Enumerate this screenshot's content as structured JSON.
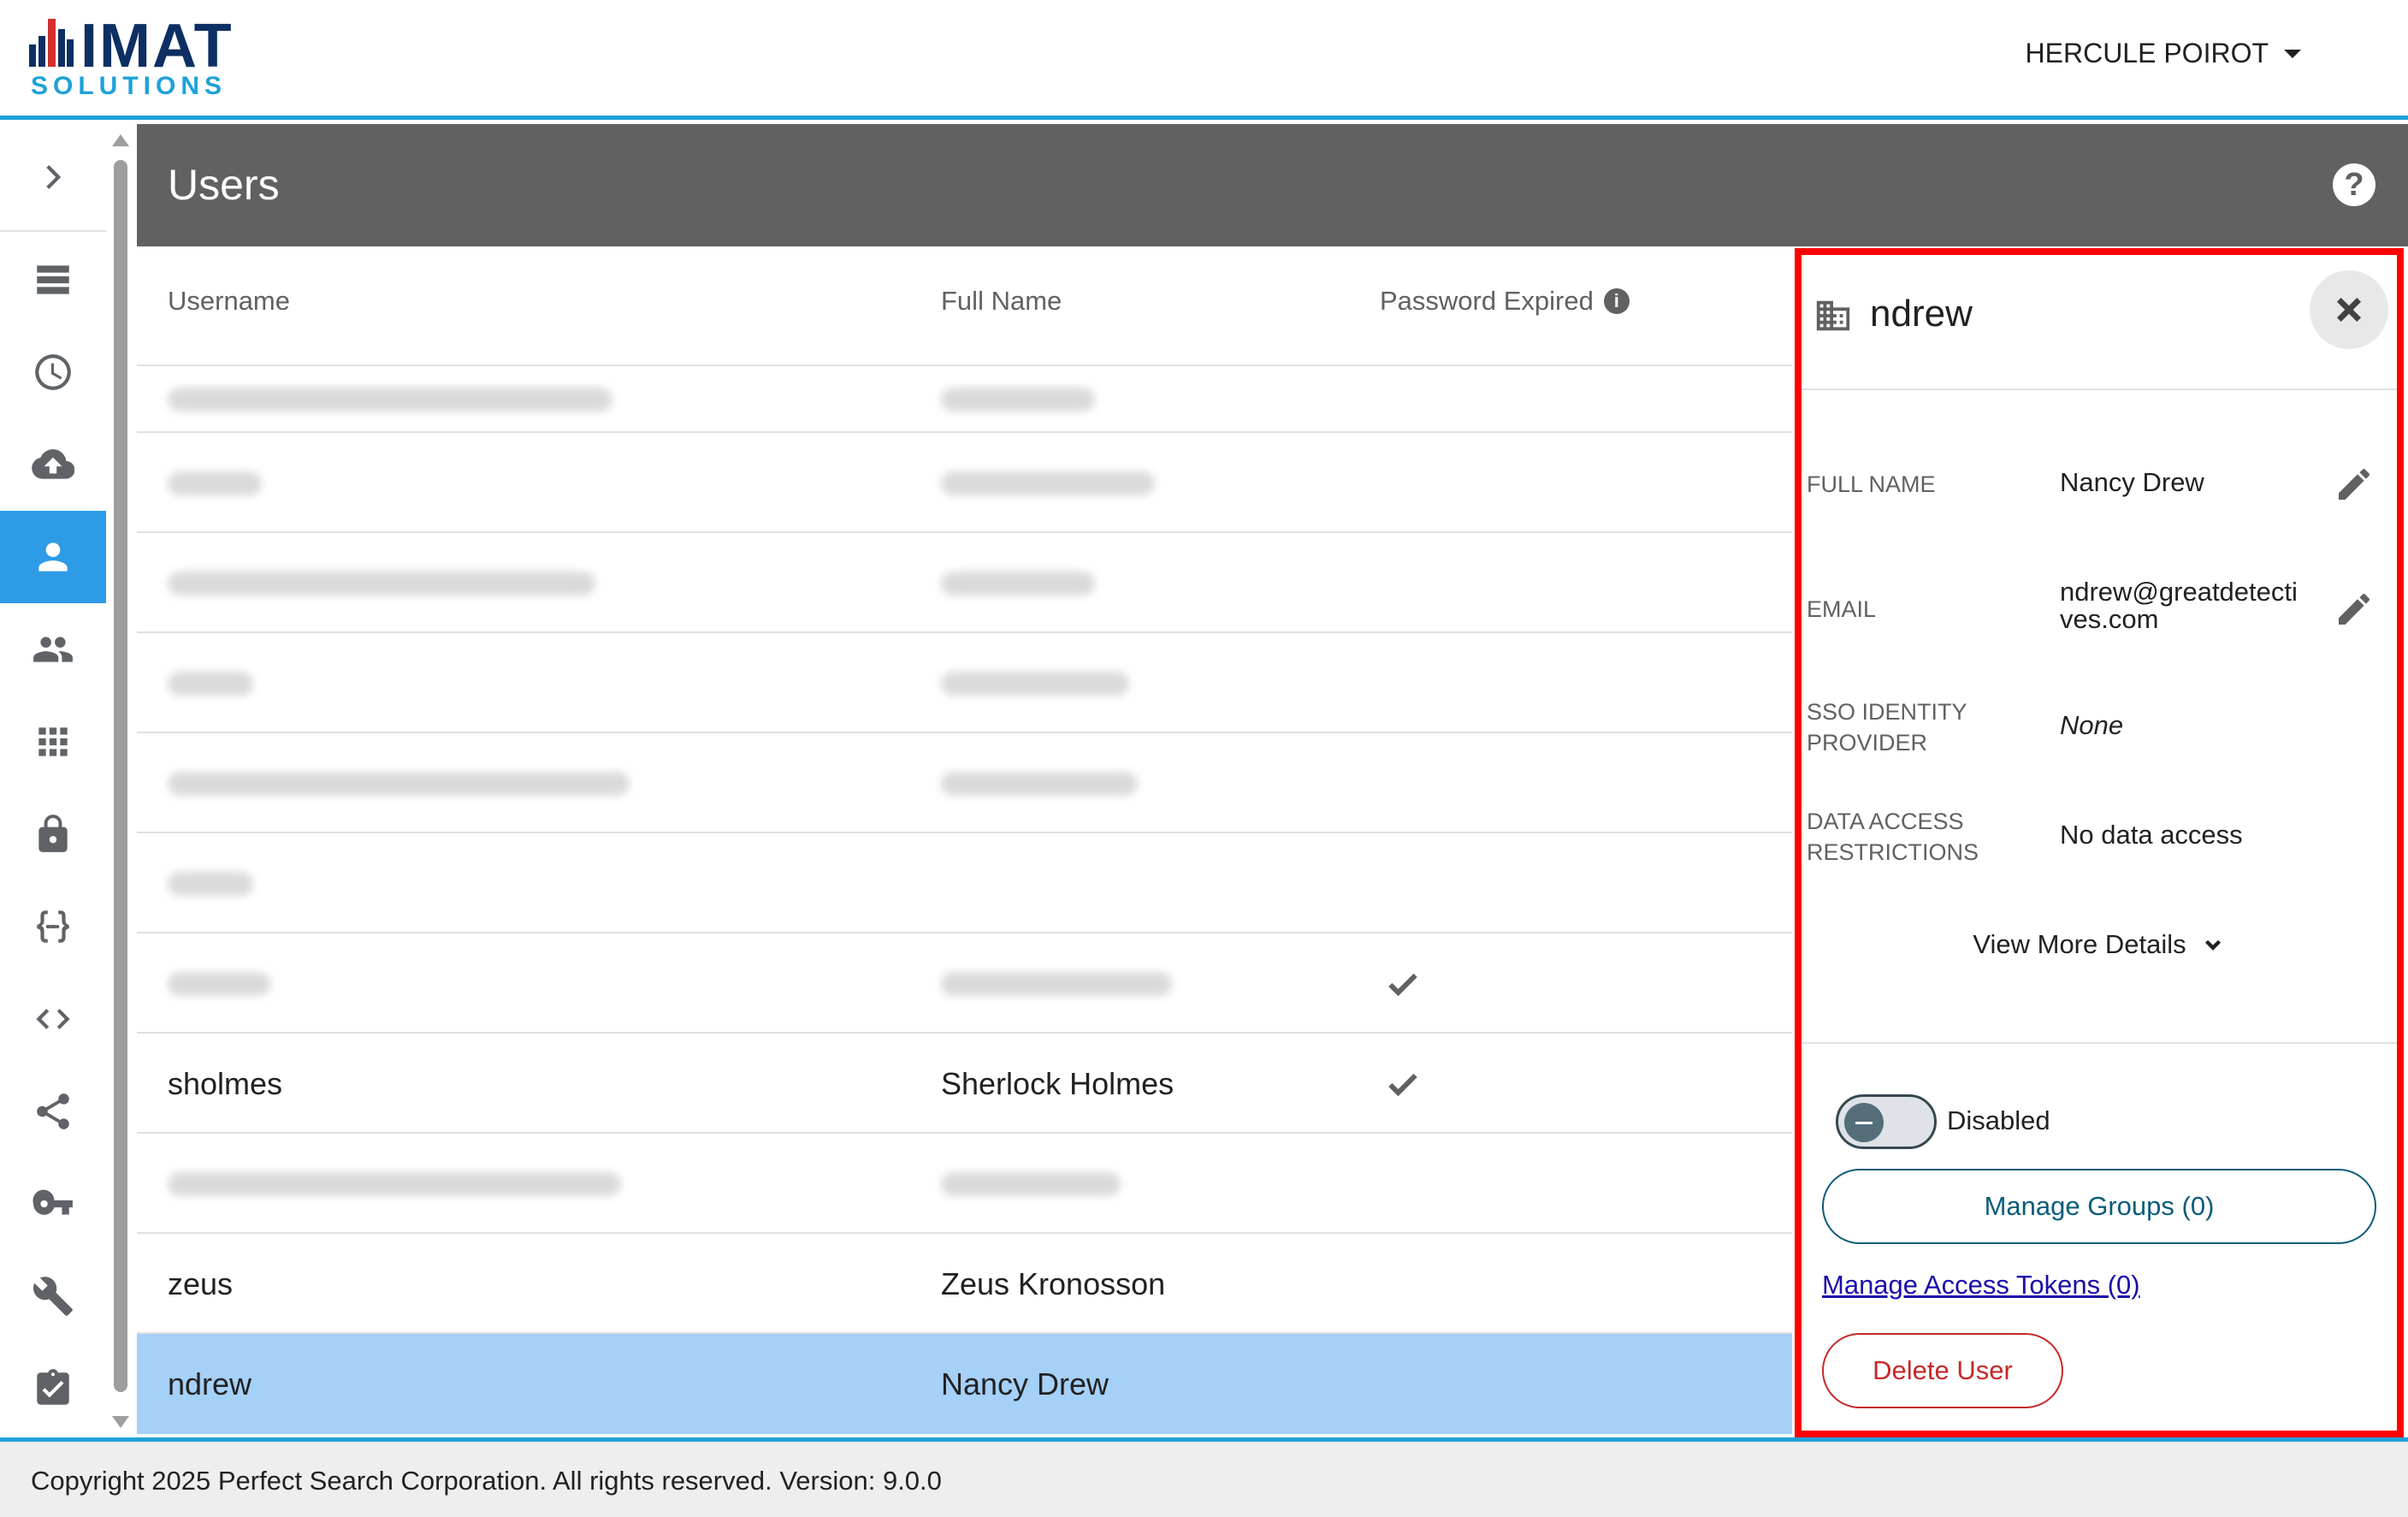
{
  "header": {
    "logo_main": "IMAT",
    "logo_sub": "SOLUTIONS",
    "user_name": "HERCULE POIROT"
  },
  "sidebar": {
    "items": [
      {
        "icon": "chevron-right-icon"
      },
      {
        "icon": "list-icon"
      },
      {
        "icon": "clock-icon"
      },
      {
        "icon": "cloud-upload-icon"
      },
      {
        "icon": "person-icon",
        "active": true
      },
      {
        "icon": "people-icon"
      },
      {
        "icon": "apps-grid-icon"
      },
      {
        "icon": "lock-icon"
      },
      {
        "icon": "braces-icon"
      },
      {
        "icon": "code-icon"
      },
      {
        "icon": "share-icon"
      },
      {
        "icon": "key-icon"
      },
      {
        "icon": "wrench-icon"
      },
      {
        "icon": "clipboard-check-icon"
      }
    ]
  },
  "page": {
    "title": "Users"
  },
  "table": {
    "columns": [
      "Username",
      "Full Name",
      "Password Expired"
    ],
    "rows": [
      {
        "username": "",
        "full_name": "",
        "expired": false,
        "blurred": true
      },
      {
        "username": "",
        "full_name": "",
        "expired": false,
        "blurred": true
      },
      {
        "username": "",
        "full_name": "",
        "expired": false,
        "blurred": true
      },
      {
        "username": "",
        "full_name": "",
        "expired": false,
        "blurred": true
      },
      {
        "username": "",
        "full_name": "",
        "expired": false,
        "blurred": true
      },
      {
        "username": "",
        "full_name": "",
        "expired": false,
        "blurred": true
      },
      {
        "username": "",
        "full_name": "",
        "expired": true,
        "blurred": true
      },
      {
        "username": "sholmes",
        "full_name": "Sherlock Holmes",
        "expired": true
      },
      {
        "username": "",
        "full_name": "",
        "expired": false,
        "blurred": true
      },
      {
        "username": "zeus",
        "full_name": "Zeus Kronosson",
        "expired": false
      },
      {
        "username": "ndrew",
        "full_name": "Nancy Drew",
        "expired": false,
        "selected": true
      }
    ]
  },
  "panel": {
    "title": "ndrew",
    "fields": {
      "full_name_label": "FULL NAME",
      "full_name_value": "Nancy Drew",
      "email_label": "EMAIL",
      "email_value": "ndrew@greatdetectives.com",
      "sso_label": "SSO IDENTITY PROVIDER",
      "sso_value": "None",
      "data_access_label": "DATA ACCESS RESTRICTIONS",
      "data_access_value": "No data access"
    },
    "view_more": "View More Details",
    "toggle_label": "Disabled",
    "manage_groups": "Manage Groups (0)",
    "manage_tokens": "Manage Access Tokens (0)",
    "delete_user": "Delete User"
  },
  "footer": {
    "text": "Copyright 2025 Perfect Search Corporation. All rights reserved. Version: 9.0.0"
  },
  "colors": {
    "accent": "#1ea1d8",
    "title_bar": "#616161",
    "selected_row": "#a5d0f7",
    "active_nav": "#2d9be6",
    "delete": "#c62828",
    "highlight_border": "#ff0000"
  }
}
